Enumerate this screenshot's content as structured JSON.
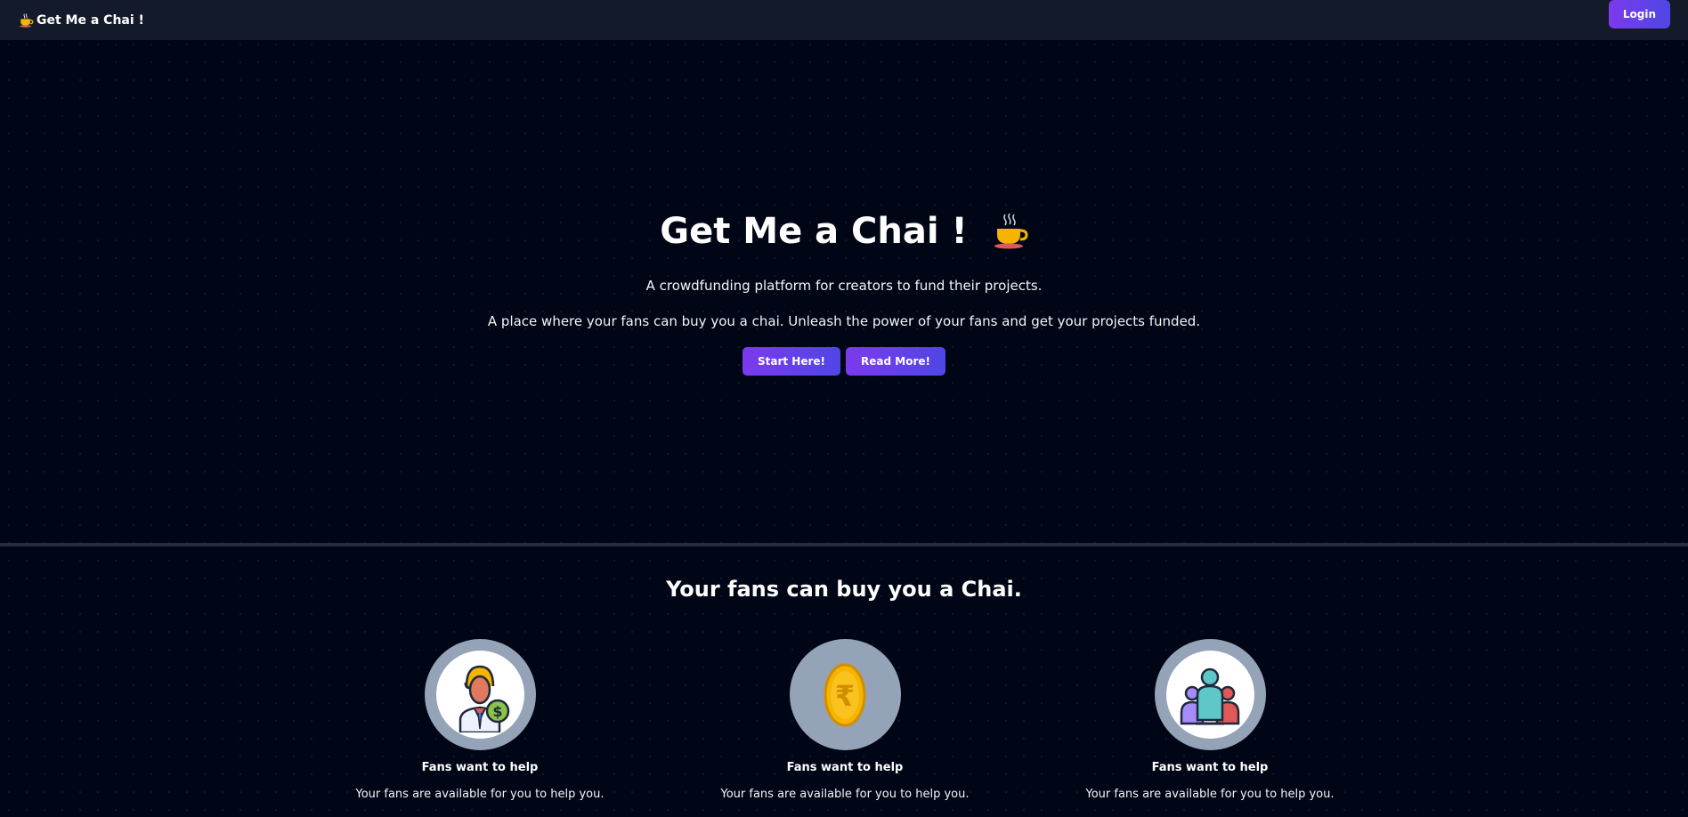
{
  "nav": {
    "brand": "Get Me a Chai !",
    "login_label": "Login"
  },
  "hero": {
    "title": "Get Me a Chai !",
    "subtitle_1": "A crowdfunding platform for creators to fund their projects.",
    "subtitle_2": "A place where your fans can buy you a chai. Unleash the power of your fans and get your projects funded.",
    "start_label": "Start Here!",
    "read_label": "Read More!"
  },
  "section": {
    "title": "Your fans can buy you a Chai."
  },
  "features": [
    {
      "icon": "man-with-dollar-icon",
      "title": "Fans want to help",
      "desc": "Your fans are available for you to help you."
    },
    {
      "icon": "rupee-coin-icon",
      "title": "Fans want to help",
      "desc": "Your fans are available for you to help you."
    },
    {
      "icon": "group-people-icon",
      "title": "Fans want to help",
      "desc": "Your fans are available for you to help you."
    }
  ],
  "colors": {
    "background": "#000615",
    "navbar": "#131a29",
    "button_gradient_start": "#7c3aed",
    "button_gradient_end": "#4f46e5",
    "circle": "#94a3b8"
  }
}
